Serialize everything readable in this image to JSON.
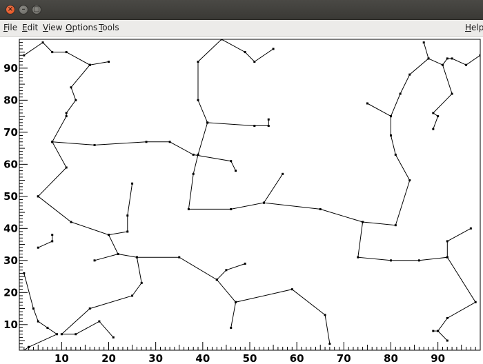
{
  "window": {
    "controls": {
      "close": "×",
      "minimize": "–",
      "maximize": "□"
    }
  },
  "menubar": {
    "file": "File",
    "edit": "Edit",
    "view": "View",
    "options": "Options",
    "tools": "Tools",
    "help": "Help"
  },
  "chart_data": {
    "type": "line",
    "title": "",
    "xlabel": "",
    "ylabel": "",
    "xlim": [
      1,
      99
    ],
    "ylim": [
      2,
      99
    ],
    "x_ticks": [
      10,
      20,
      30,
      40,
      50,
      60,
      70,
      80,
      90
    ],
    "y_ticks": [
      10,
      20,
      30,
      40,
      50,
      60,
      70,
      80,
      90
    ],
    "grid": false,
    "line_color": "#000000",
    "marker": "dot",
    "segments": [
      [
        [
          2,
          94
        ],
        [
          6,
          98
        ],
        [
          8,
          95
        ],
        [
          11,
          95
        ],
        [
          16,
          91
        ],
        [
          20,
          92
        ]
      ],
      [
        [
          16,
          91
        ],
        [
          12,
          84
        ],
        [
          13,
          80
        ],
        [
          11,
          76
        ],
        [
          11,
          75
        ],
        [
          8,
          67
        ],
        [
          11,
          59
        ],
        [
          5,
          50
        ]
      ],
      [
        [
          8,
          67
        ],
        [
          17,
          66
        ],
        [
          28,
          67
        ],
        [
          33,
          67
        ],
        [
          38,
          63
        ],
        [
          46,
          61
        ],
        [
          47,
          58
        ]
      ],
      [
        [
          5,
          50
        ],
        [
          12,
          42
        ],
        [
          20,
          38
        ],
        [
          22,
          32
        ],
        [
          17,
          30
        ]
      ],
      [
        [
          20,
          38
        ],
        [
          24,
          39
        ],
        [
          24,
          44
        ],
        [
          25,
          54
        ]
      ],
      [
        [
          22,
          32
        ],
        [
          26,
          31
        ],
        [
          35,
          31
        ],
        [
          43,
          24
        ],
        [
          47,
          17
        ],
        [
          59,
          21
        ],
        [
          66,
          13
        ],
        [
          67,
          4
        ]
      ],
      [
        [
          26,
          31
        ],
        [
          27,
          23
        ],
        [
          25,
          19
        ],
        [
          16,
          15
        ],
        [
          10,
          7
        ],
        [
          13,
          7
        ],
        [
          18,
          11
        ],
        [
          21,
          6
        ]
      ],
      [
        [
          43,
          24
        ],
        [
          45,
          27
        ],
        [
          49,
          29
        ]
      ],
      [
        [
          47,
          17
        ],
        [
          46,
          9
        ]
      ],
      [
        [
          2,
          26
        ],
        [
          4,
          15
        ],
        [
          5,
          11
        ],
        [
          7,
          9
        ],
        [
          9,
          7
        ],
        [
          3,
          3
        ]
      ],
      [
        [
          3,
          3
        ],
        [
          1,
          1
        ]
      ],
      [
        [
          5,
          34
        ],
        [
          8,
          36
        ],
        [
          8,
          38
        ]
      ],
      [
        [
          39,
          63
        ],
        [
          38,
          57
        ],
        [
          37,
          46
        ],
        [
          46,
          46
        ],
        [
          53,
          48
        ],
        [
          65,
          46
        ],
        [
          74,
          42
        ],
        [
          81,
          41
        ],
        [
          84,
          55
        ],
        [
          81,
          63
        ],
        [
          80,
          69
        ],
        [
          80,
          75
        ],
        [
          82,
          82
        ],
        [
          84,
          88
        ],
        [
          88,
          93
        ],
        [
          87,
          98
        ]
      ],
      [
        [
          39,
          63
        ],
        [
          41,
          73
        ],
        [
          51,
          72
        ],
        [
          54,
          72
        ],
        [
          54,
          74
        ]
      ],
      [
        [
          41,
          73
        ],
        [
          39,
          80
        ],
        [
          39,
          92
        ],
        [
          44,
          99
        ],
        [
          49,
          95
        ],
        [
          51,
          92
        ],
        [
          55,
          96
        ]
      ],
      [
        [
          53,
          48
        ],
        [
          57,
          57
        ]
      ],
      [
        [
          74,
          42
        ],
        [
          73,
          31
        ],
        [
          80,
          30
        ],
        [
          86,
          30
        ],
        [
          92,
          31
        ],
        [
          98,
          17
        ],
        [
          92,
          12
        ],
        [
          90,
          8
        ],
        [
          92,
          5
        ]
      ],
      [
        [
          92,
          31
        ],
        [
          92,
          36
        ],
        [
          97,
          40
        ]
      ],
      [
        [
          88,
          93
        ],
        [
          91,
          91
        ],
        [
          93,
          82
        ],
        [
          89,
          76
        ],
        [
          90,
          75
        ],
        [
          89,
          71
        ]
      ],
      [
        [
          91,
          91
        ],
        [
          92,
          93
        ],
        [
          93,
          93
        ],
        [
          96,
          91
        ],
        [
          99,
          94
        ]
      ],
      [
        [
          80,
          75
        ],
        [
          75,
          79
        ]
      ],
      [
        [
          90,
          8
        ],
        [
          89,
          8
        ]
      ]
    ]
  }
}
